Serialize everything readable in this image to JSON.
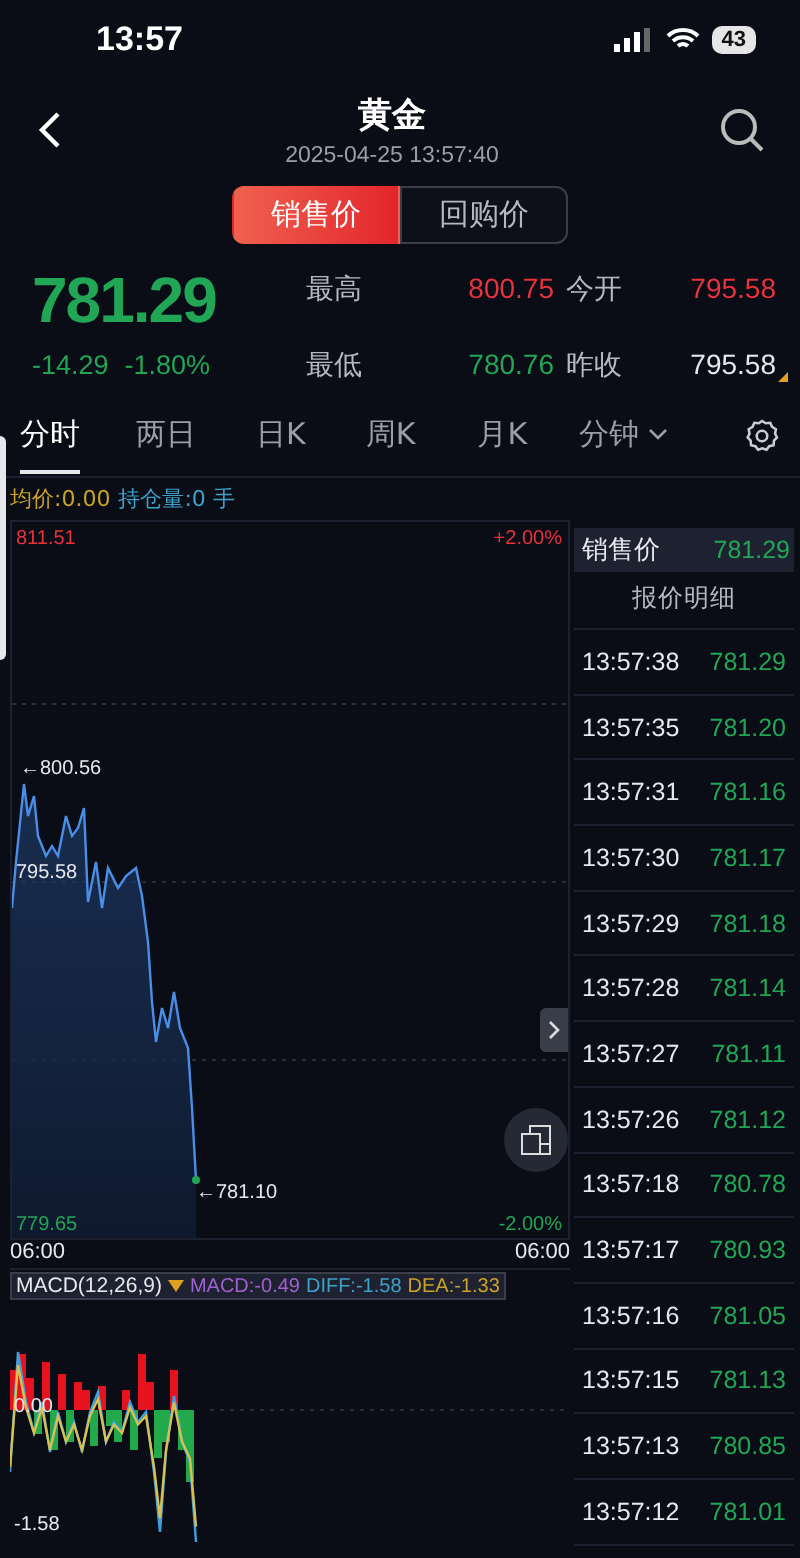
{
  "status_bar": {
    "time": "13:57",
    "battery": "43"
  },
  "header": {
    "title": "黄金",
    "timestamp": "2025-04-25 13:57:40"
  },
  "price_toggle": [
    {
      "label": "销售价",
      "selected": true
    },
    {
      "label": "回购价",
      "selected": false
    }
  ],
  "quote": {
    "price": "781.29",
    "change": "-14.29",
    "change_pct": "-1.80%",
    "color": "#21a656",
    "stats": [
      {
        "label": "最高",
        "value": "800.75",
        "color": "#e8323c",
        "flagged": false
      },
      {
        "label": "今开",
        "value": "795.58",
        "color": "#e8323c",
        "flagged": false
      },
      {
        "label": "最低",
        "value": "780.76",
        "color": "#21a656",
        "flagged": false
      },
      {
        "label": "昨收",
        "value": "795.58",
        "color": "#e6e8ee",
        "flagged": true
      }
    ]
  },
  "tabs": [
    {
      "label": "分时",
      "selected": true,
      "kind": "plain"
    },
    {
      "label": "两日",
      "selected": false,
      "kind": "plain"
    },
    {
      "label": "日K",
      "selected": false,
      "kind": "plain"
    },
    {
      "label": "周K",
      "selected": false,
      "kind": "plain"
    },
    {
      "label": "月K",
      "selected": false,
      "kind": "plain"
    },
    {
      "label": "分钟",
      "selected": false,
      "kind": "dropdown"
    }
  ],
  "info": {
    "average": "均价:0.00",
    "position": "持仓量:0 手"
  },
  "chart": {
    "y_max": "811.51",
    "y_max_pct": "+2.00%",
    "y_min": "779.65",
    "y_min_pct": "-2.00%",
    "prev_close": "795.58",
    "high_marker": "←800.56",
    "last_marker": "←781.10",
    "x_start": "06:00",
    "x_end": "06:00"
  },
  "macd": {
    "title": "MACD(12,26,9)",
    "macd": "MACD:-0.49",
    "diff": "DIFF:-1.58",
    "dea": "DEA:-1.33",
    "zero": "0.00",
    "min": "-1.58"
  },
  "side_panel": {
    "header_label": "销售价",
    "header_value": "781.29",
    "title": "报价明细",
    "rows": [
      {
        "time": "13:57:38",
        "price": "781.29"
      },
      {
        "time": "13:57:35",
        "price": "781.20"
      },
      {
        "time": "13:57:31",
        "price": "781.16"
      },
      {
        "time": "13:57:30",
        "price": "781.17"
      },
      {
        "time": "13:57:29",
        "price": "781.18"
      },
      {
        "time": "13:57:28",
        "price": "781.14"
      },
      {
        "time": "13:57:27",
        "price": "781.11"
      },
      {
        "time": "13:57:26",
        "price": "781.12"
      },
      {
        "time": "13:57:18",
        "price": "780.78"
      },
      {
        "time": "13:57:17",
        "price": "780.93"
      },
      {
        "time": "13:57:16",
        "price": "781.05"
      },
      {
        "time": "13:57:15",
        "price": "781.13"
      },
      {
        "time": "13:57:13",
        "price": "780.85"
      },
      {
        "time": "13:57:12",
        "price": "781.01"
      }
    ]
  }
}
